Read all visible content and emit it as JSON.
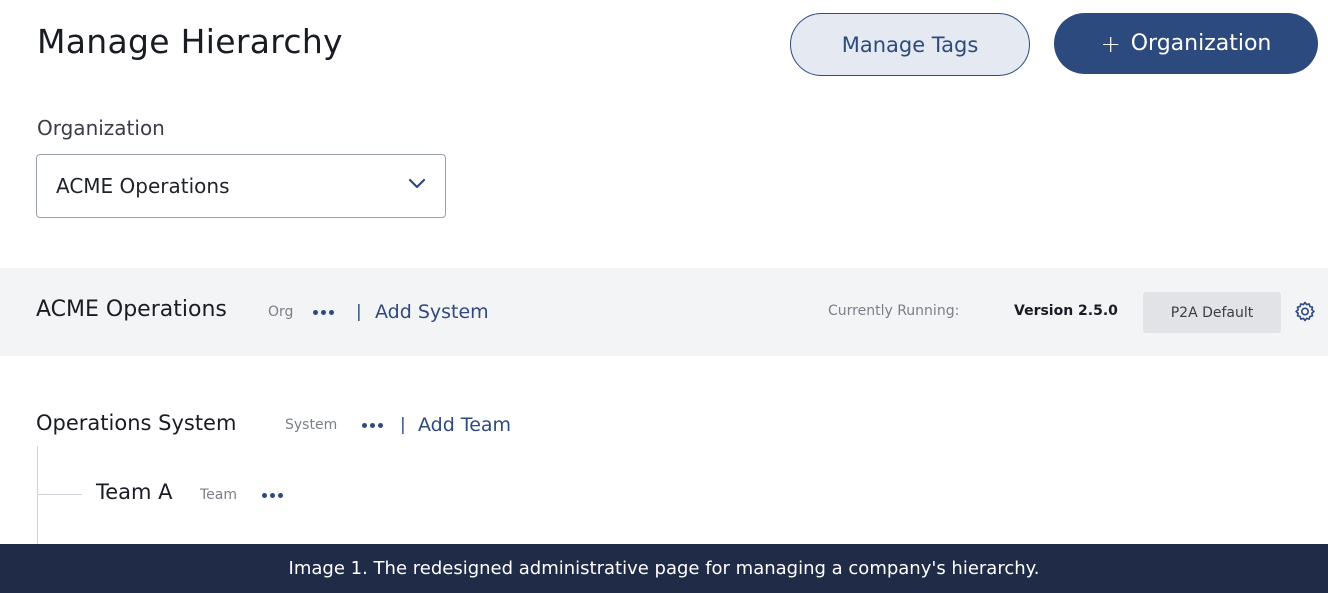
{
  "header": {
    "title": "Manage Hierarchy",
    "manage_tags_label": "Manage Tags",
    "add_org_plus": "+",
    "add_org_label": "Organization"
  },
  "org_selector": {
    "label": "Organization",
    "selected": "ACME Operations"
  },
  "org_row": {
    "name": "ACME Operations",
    "type": "Org",
    "separator": "|",
    "add_link": "Add System",
    "running_label": "Currently Running:",
    "version": "Version 2.5.0",
    "config": "P2A Default"
  },
  "system_row": {
    "name": "Operations System",
    "type": "System",
    "separator": "|",
    "add_link": "Add Team"
  },
  "team_row": {
    "name": "Team A",
    "type": "Team"
  },
  "caption": "Image 1. The redesigned administrative page for managing a company's hierarchy.",
  "colors": {
    "primary": "#2c4a7d",
    "caption_bg": "#1f2b47",
    "row_bg": "#f3f4f6"
  }
}
